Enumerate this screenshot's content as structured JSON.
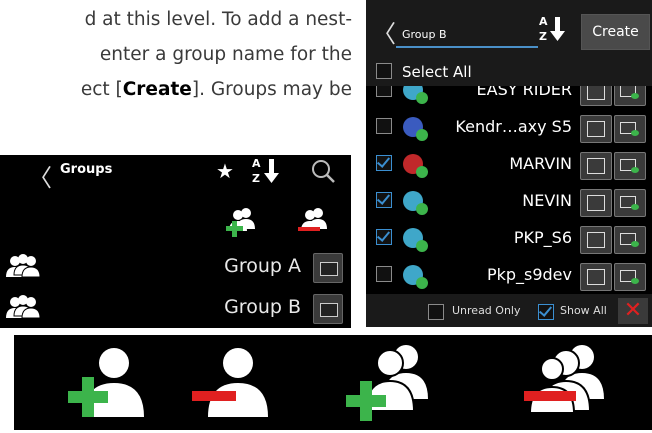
{
  "manual_text": {
    "line1": "d at this level. To add a nest-",
    "line2": " enter a group name for the",
    "line3_pre": "ect [",
    "line3_bold": "Create",
    "line3_post": "]. Groups may be"
  },
  "groups_screen": {
    "title": "Groups",
    "icons": {
      "back": "chevron-left-icon",
      "favorite": "star-icon",
      "sort": "sort-az-icon",
      "search": "search-icon",
      "add_group": "add-group-icon",
      "remove_group": "remove-group-icon"
    },
    "groups": [
      {
        "label": "Group A"
      },
      {
        "label": "Group B"
      }
    ]
  },
  "group_b_screen": {
    "group_name_value": "Group B",
    "create_label": "Create",
    "select_all_label": "Select All",
    "members": [
      {
        "name": "EASY RIDER",
        "checked": false,
        "avatar_color": "#3fa7c9"
      },
      {
        "name": "Kendr…axy S5",
        "checked": false,
        "avatar_color": "#3a5bbf"
      },
      {
        "name": "MARVIN",
        "checked": true,
        "avatar_color": "#c0282a"
      },
      {
        "name": "NEVIN",
        "checked": true,
        "avatar_color": "#3fa7c9"
      },
      {
        "name": "PKP_S6",
        "checked": true,
        "avatar_color": "#3fa7c9"
      },
      {
        "name": "Pkp_s9dev",
        "checked": false,
        "avatar_color": "#3fa7c9"
      }
    ],
    "footer": {
      "unread_only_label": "Unread Only",
      "unread_only_checked": false,
      "show_all_label": "Show All",
      "show_all_checked": true,
      "close_symbol": "✕"
    }
  },
  "legend_icons": [
    "add-user-icon",
    "remove-user-icon",
    "add-group-icon",
    "remove-group-icon"
  ],
  "colors": {
    "accent_blue": "#3b8fd1",
    "add_green": "#3cb44b",
    "remove_red": "#e02020",
    "screen_bg": "#000000"
  }
}
